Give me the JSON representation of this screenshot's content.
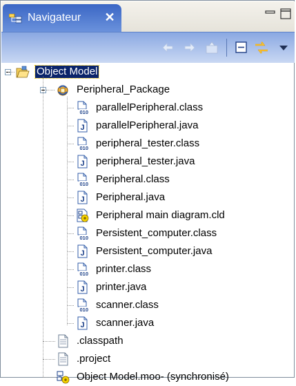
{
  "view": {
    "title": "Navigateur",
    "close_glyph": "✕",
    "icon": "navigator-icon"
  },
  "window_controls": [
    "minimize-icon",
    "maximize-icon"
  ],
  "toolbar": [
    "back-arrow-icon",
    "forward-arrow-icon",
    "up-folder-icon",
    "collapse-all-icon",
    "link-with-editor-icon",
    "view-menu-icon"
  ],
  "tree": {
    "root": {
      "label": "Object Model",
      "icon": "open-project-folder-icon",
      "expanded": true,
      "selected": true
    },
    "package": {
      "label": "Peripheral_Package",
      "icon": "package-icon",
      "expanded": true
    },
    "files": [
      {
        "label": "parallelPeripheral.class",
        "icon": "class-file-icon"
      },
      {
        "label": "parallelPeripheral.java",
        "icon": "java-file-icon"
      },
      {
        "label": "peripheral_tester.class",
        "icon": "class-file-icon"
      },
      {
        "label": "peripheral_tester.java",
        "icon": "java-file-icon"
      },
      {
        "label": "Peripheral.class",
        "icon": "class-file-icon"
      },
      {
        "label": "Peripheral.java",
        "icon": "java-file-icon"
      },
      {
        "label": "Peripheral main diagram.cld",
        "icon": "diagram-file-icon"
      },
      {
        "label": "Persistent_computer.class",
        "icon": "class-file-icon"
      },
      {
        "label": "Persistent_computer.java",
        "icon": "java-file-icon"
      },
      {
        "label": "printer.class",
        "icon": "class-file-icon"
      },
      {
        "label": "printer.java",
        "icon": "java-file-icon"
      },
      {
        "label": "scanner.class",
        "icon": "class-file-icon"
      },
      {
        "label": "scanner.java",
        "icon": "java-file-icon"
      }
    ],
    "root_files": [
      {
        "label": ".classpath",
        "icon": "text-file-icon"
      },
      {
        "label": ".project",
        "icon": "text-file-icon"
      },
      {
        "label": "Object Model.moo- (synchronisé)",
        "icon": "model-file-icon"
      }
    ]
  }
}
